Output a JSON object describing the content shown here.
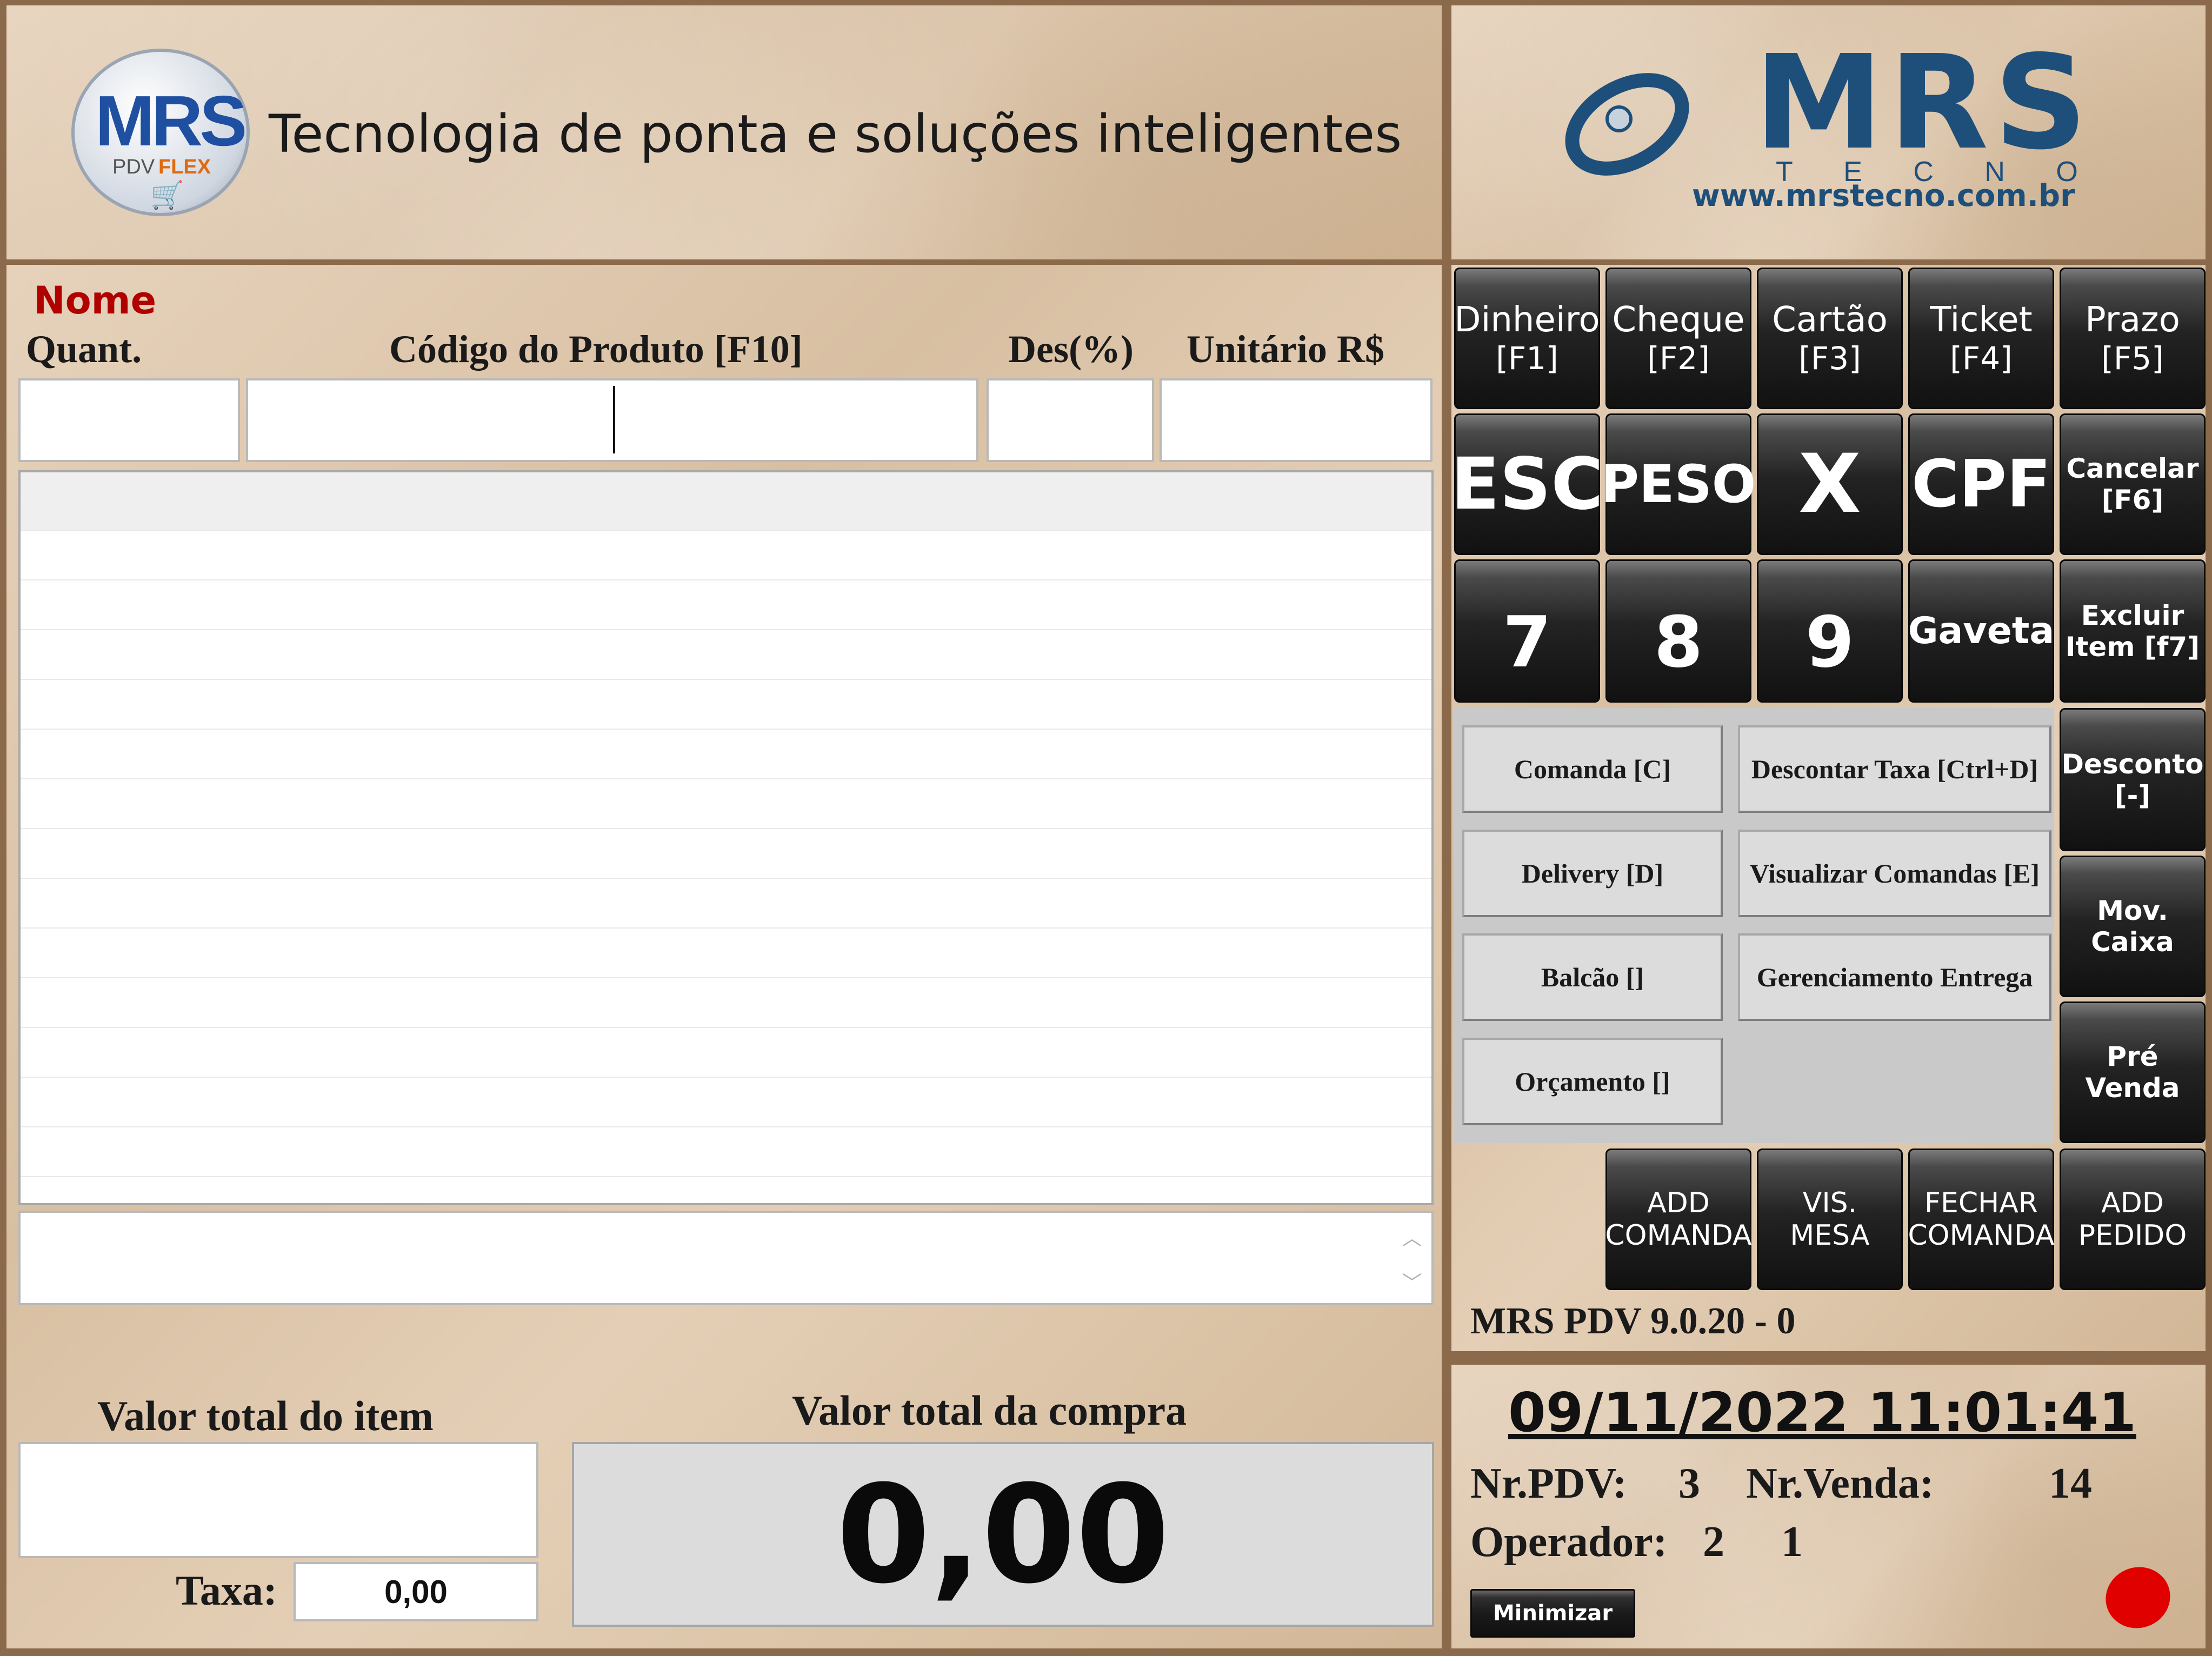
{
  "header": {
    "logo_text": "MRS",
    "logo_sub_pdv": "PDV",
    "logo_sub_flex": "FLEX",
    "tagline": "Tecnologia de ponta e soluções inteligentes",
    "brand_name": "MRS",
    "brand_sub": "T E C N O",
    "brand_url": "www.mrstecno.com.br"
  },
  "entry": {
    "nome_label": "Nome",
    "quant_label": "Quant.",
    "codigo_label": "Código do Produto [F10]",
    "desc_label": "Des(%)",
    "unitario_label": "Unitário R$",
    "quant_value": "",
    "codigo_value": "",
    "desc_value": "",
    "unitario_value": ""
  },
  "items_table": {
    "rows": 14
  },
  "totals": {
    "item_label": "Valor total do item",
    "item_value": "",
    "compra_label": "Valor total da compra",
    "compra_value": "0,00",
    "taxa_label": "Taxa:",
    "taxa_value": "0,00"
  },
  "payment_keys": [
    {
      "label": "Dinheiro",
      "key": "[F1]"
    },
    {
      "label": "Cheque",
      "key": "[F2]"
    },
    {
      "label": "Cartão",
      "key": "[F3]"
    },
    {
      "label": "Ticket",
      "key": "[F4]"
    },
    {
      "label": "Prazo",
      "key": "[F5]"
    }
  ],
  "keys": {
    "esc": "ESC",
    "peso": "PESO",
    "x": "X",
    "cpf": "CPF",
    "cancelar": "Cancelar",
    "cancelar_key": "[F6]",
    "seven": "7",
    "eight": "8",
    "nine": "9",
    "gaveta": "Gaveta",
    "excluir": "Excluir",
    "excluir_key": "Item [f7]",
    "desconto": "Desconto",
    "desconto_key": "[-]",
    "mov": "Mov.",
    "mov_key": "Caixa",
    "pre_venda": "Pré Venda"
  },
  "actions": {
    "comanda": "Comanda [C]",
    "descontar_taxa": "Descontar Taxa [Ctrl+D]",
    "delivery": "Delivery [D]",
    "visualizar_comandas": "Visualizar Comandas [E]",
    "balcao": "Balcão []",
    "gerenciamento_entrega": "Gerenciamento Entrega",
    "orcamento": "Orçamento []"
  },
  "bottom_keys": [
    {
      "l1": "ADD",
      "l2": "COMANDA"
    },
    {
      "l1": "VIS.",
      "l2": "MESA"
    },
    {
      "l1": "FECHAR",
      "l2": "COMANDA"
    },
    {
      "l1": "ADD",
      "l2": "PEDIDO"
    }
  ],
  "version": "MRS PDV 9.0.20 - 0",
  "status": {
    "datetime": "09/11/2022 11:01:41",
    "nr_pdv_label": "Nr.PDV:",
    "nr_pdv": "3",
    "nr_venda_label": "Nr.Venda:",
    "nr_venda": "14",
    "operador_label": "Operador:",
    "operador_a": "2",
    "operador_b": "1",
    "minimizar": "Minimizar",
    "indicator_color": "#e00000"
  },
  "colors": {
    "nome_red": "#b00000",
    "brand_blue": "#1e4f7a"
  }
}
